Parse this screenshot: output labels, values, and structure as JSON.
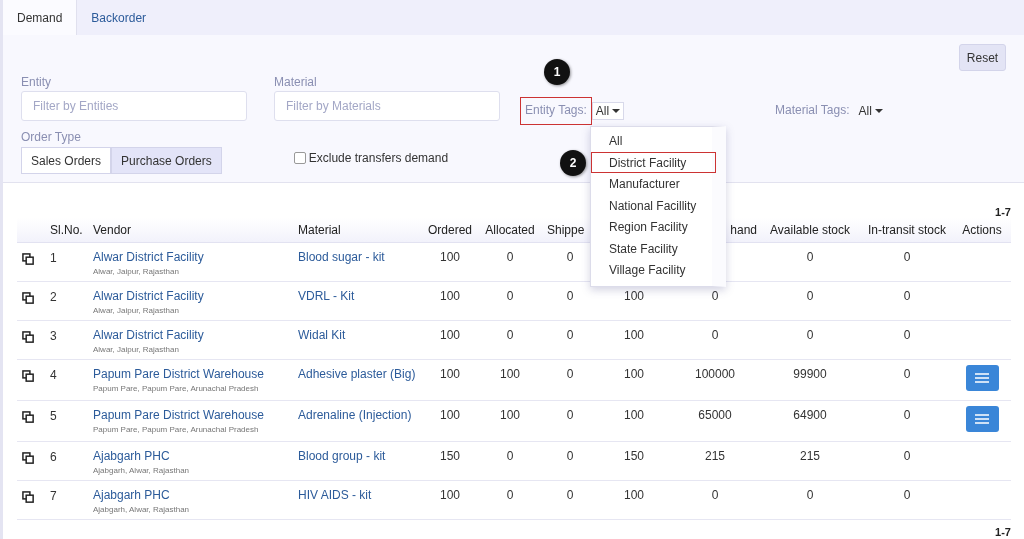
{
  "tabs": [
    {
      "label": "Demand",
      "selected": true
    },
    {
      "label": "Backorder",
      "selected": false
    }
  ],
  "reset_button": "Reset",
  "filters": {
    "entity": {
      "label": "Entity",
      "placeholder": "Filter by Entities"
    },
    "material": {
      "label": "Material",
      "placeholder": "Filter by Materials"
    },
    "entity_tags": {
      "label": "Entity Tags:",
      "value": "All",
      "annotation": "1",
      "expanded": true,
      "options": [
        {
          "label": "All"
        },
        {
          "label": "District Facility",
          "annotation": "2"
        },
        {
          "label": "Manufacturer"
        },
        {
          "label": "National Facillity"
        },
        {
          "label": "Region Facility"
        },
        {
          "label": "State Facility"
        },
        {
          "label": "Village Facility"
        }
      ]
    },
    "material_tags": {
      "label": "Material Tags:",
      "value": "All"
    },
    "order_type": {
      "label": "Order Type",
      "options": [
        {
          "label": "Sales Orders",
          "selected": false
        },
        {
          "label": "Purchase Orders",
          "selected": true
        }
      ]
    },
    "exclude_transfers": {
      "label": "Exclude transfers demand",
      "checked": false
    }
  },
  "pagination_top": "1-7",
  "table": {
    "columns": {
      "sl_no": "Sl.No.",
      "vendor": "Vendor",
      "material": "Material",
      "ordered": "Ordered",
      "allocated": "Allocated",
      "shipped": "Shippe",
      "on_hand": "hand",
      "available_stock": "Available stock",
      "in_transit_stock": "In-transit stock",
      "actions": "Actions"
    },
    "rows": [
      {
        "sl": "1",
        "vendor": "Alwar District Facility",
        "location": "Alwar, Jaipur, Rajasthan",
        "material": "Blood sugar - kit",
        "ordered": "100",
        "allocated": "0",
        "shipped": "0",
        "available_stock": "0",
        "in_transit_stock": "0",
        "has_action": false
      },
      {
        "sl": "2",
        "vendor": "Alwar District Facility",
        "location": "Alwar, Jaipur, Rajasthan",
        "material": "VDRL - Kit",
        "ordered": "100",
        "allocated": "0",
        "shipped": "0",
        "column_9": "100",
        "on_hand": "0",
        "available_stock": "0",
        "in_transit_stock": "0",
        "has_action": false
      },
      {
        "sl": "3",
        "vendor": "Alwar District Facility",
        "location": "Alwar, Jaipur, Rajasthan",
        "material": "Widal Kit",
        "ordered": "100",
        "allocated": "0",
        "shipped": "0",
        "column_9": "100",
        "on_hand": "0",
        "available_stock": "0",
        "in_transit_stock": "0",
        "has_action": false
      },
      {
        "sl": "4",
        "vendor": "Papum Pare District Warehouse",
        "location": "Papum Pare, Papum Pare, Arunachal Pradesh",
        "material": "Adhesive plaster (Big)",
        "ordered": "100",
        "allocated": "100",
        "shipped": "0",
        "column_9": "100",
        "on_hand": "100000",
        "available_stock": "99900",
        "in_transit_stock": "0",
        "has_action": true
      },
      {
        "sl": "5",
        "vendor": "Papum Pare District Warehouse",
        "location": "Papum Pare, Papum Pare, Arunachal Pradesh",
        "material": "Adrenaline (Injection)",
        "ordered": "100",
        "allocated": "100",
        "shipped": "0",
        "column_9": "100",
        "on_hand": "65000",
        "available_stock": "64900",
        "in_transit_stock": "0",
        "has_action": true
      },
      {
        "sl": "6",
        "vendor": "Ajabgarh PHC",
        "location": "Ajabgarh, Alwar, Rajasthan",
        "material": "Blood group - kit",
        "ordered": "150",
        "allocated": "0",
        "shipped": "0",
        "column_9": "150",
        "on_hand": "215",
        "available_stock": "215",
        "in_transit_stock": "0",
        "has_action": false
      },
      {
        "sl": "7",
        "vendor": "Ajabgarh PHC",
        "location": "Ajabgarh, Alwar, Rajasthan",
        "material": "HIV AIDS - kit",
        "ordered": "100",
        "allocated": "0",
        "shipped": "0",
        "column_9": "100",
        "on_hand": "0",
        "available_stock": "0",
        "in_transit_stock": "0",
        "has_action": false
      }
    ]
  },
  "pagination_bottom": "1-7"
}
